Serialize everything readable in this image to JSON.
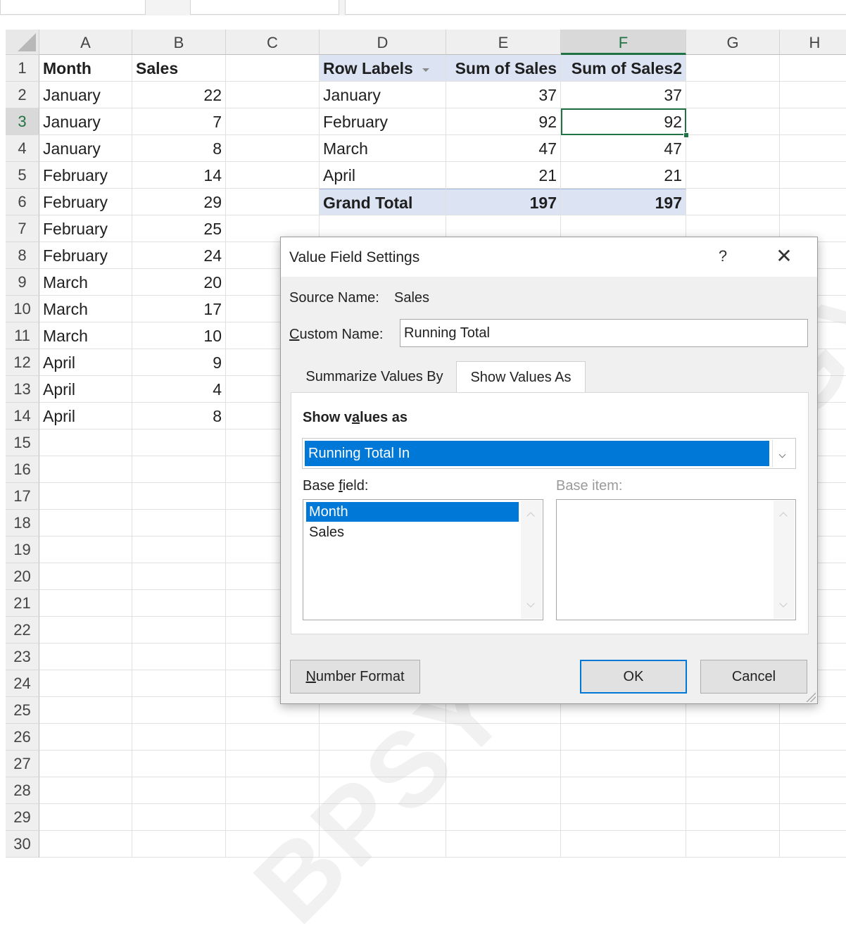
{
  "columns": [
    "A",
    "B",
    "C",
    "D",
    "E",
    "F",
    "G",
    "H"
  ],
  "rows": [
    "1",
    "2",
    "3",
    "4",
    "5",
    "6",
    "7",
    "8",
    "9",
    "10",
    "11",
    "12",
    "13",
    "14",
    "15",
    "16",
    "17",
    "18",
    "19",
    "20",
    "21",
    "22",
    "23",
    "24",
    "25",
    "26",
    "27",
    "28",
    "29",
    "30"
  ],
  "source_table": {
    "headers": [
      "Month",
      "Sales"
    ],
    "rows": [
      [
        "January",
        "22"
      ],
      [
        "January",
        "7"
      ],
      [
        "January",
        "8"
      ],
      [
        "February",
        "14"
      ],
      [
        "February",
        "29"
      ],
      [
        "February",
        "25"
      ],
      [
        "February",
        "24"
      ],
      [
        "March",
        "20"
      ],
      [
        "March",
        "17"
      ],
      [
        "March",
        "10"
      ],
      [
        "April",
        "9"
      ],
      [
        "April",
        "4"
      ],
      [
        "April",
        "8"
      ]
    ]
  },
  "pivot": {
    "headers": [
      "Row Labels",
      "Sum of Sales",
      "Sum of Sales2"
    ],
    "rows": [
      [
        "January",
        "37",
        "37"
      ],
      [
        "February",
        "92",
        "92"
      ],
      [
        "March",
        "47",
        "47"
      ],
      [
        "April",
        "21",
        "21"
      ]
    ],
    "total": [
      "Grand Total",
      "197",
      "197"
    ]
  },
  "selection": {
    "active_cell": "F3",
    "selected_column": "F",
    "selected_row": "3"
  },
  "dialog": {
    "title": "Value Field Settings",
    "help": "?",
    "close": "✕",
    "source_name_label": "Source Name:",
    "source_name_value": "Sales",
    "custom_name_label_hotkey": "C",
    "custom_name_label_rest": "ustom Name:",
    "custom_name_value": "Running Total",
    "tabs": [
      "Summarize Values By",
      "Show Values As"
    ],
    "active_tab": "Show Values As",
    "show_values_as_label_pre": "Show v",
    "show_values_as_label_hotkey": "a",
    "show_values_as_label_post": "lues as",
    "show_values_as_value": "Running Total In",
    "base_field_label_pre": "Base ",
    "base_field_label_hotkey": "f",
    "base_field_label_post": "ield:",
    "base_field_items": [
      "Month",
      "Sales"
    ],
    "base_field_selected": "Month",
    "base_item_label": "Base item:",
    "number_format_hotkey": "N",
    "number_format_rest": "umber Format",
    "ok_label": "OK",
    "cancel_label": "Cancel"
  },
  "watermark": "BPSYCHOLOGY.COM",
  "colors": {
    "excel_green": "#217346",
    "selection_blue": "#0078d7",
    "pivot_header": "#dce3f3"
  }
}
